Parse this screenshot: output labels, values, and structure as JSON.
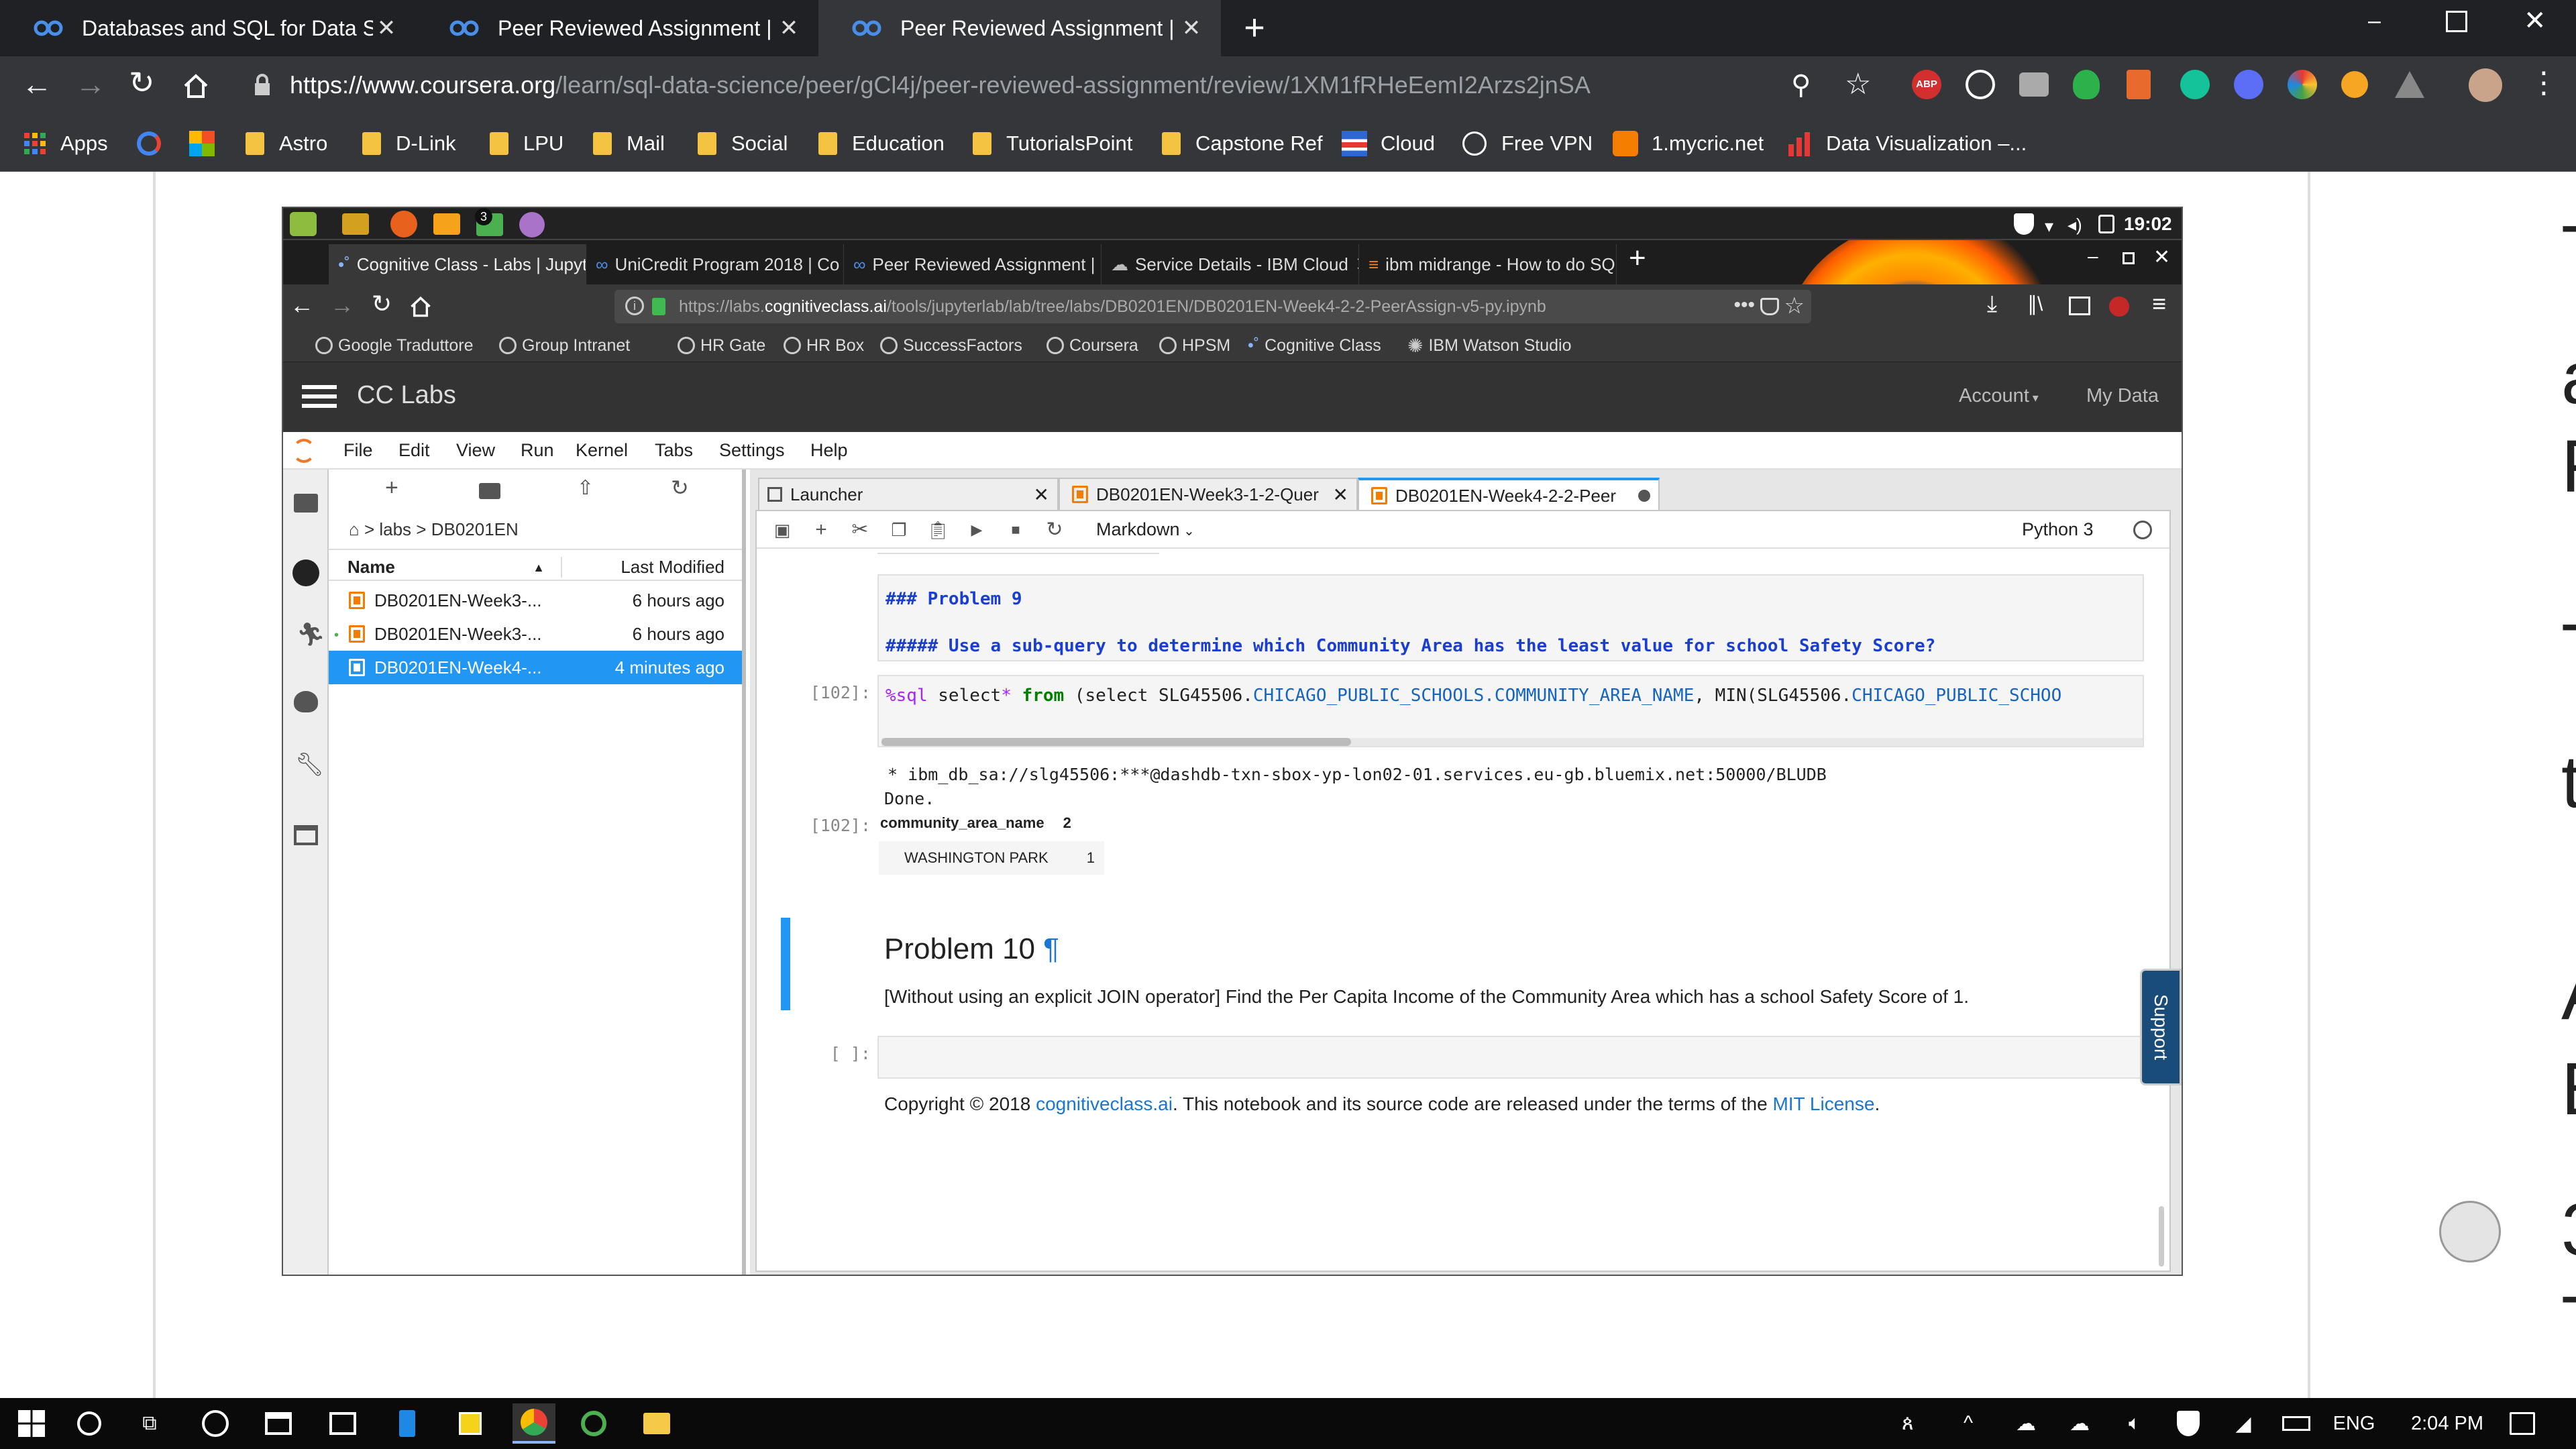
{
  "outer_browser": {
    "tabs": [
      {
        "title": "Databases and SQL for Data Scie"
      },
      {
        "title": "Peer Reviewed Assignment | Cou"
      },
      {
        "title": "Peer Reviewed Assignment | Cou"
      }
    ],
    "url_host": "https://www.coursera.org",
    "url_path": "/learn/sql-data-science/peer/gCl4j/peer-reviewed-assignment/review/1XM1fRHeEemI2Arzs2jnSA",
    "extension_abp": "ABP",
    "bookmarks": [
      "Apps",
      "Astro",
      "D-Link",
      "LPU",
      "Mail",
      "Social",
      "Education",
      "TutorialsPoint",
      "Capstone Ref",
      "Cloud",
      "Free VPN",
      "1.mycric.net",
      "Data Visualization –..."
    ],
    "right_page_chars": [
      "T",
      "a",
      "F",
      "T",
      "t",
      "A",
      "E",
      "3",
      "T"
    ]
  },
  "inner_desktop": {
    "clock": "19:02",
    "badge": "3"
  },
  "firefox": {
    "tabs": [
      {
        "title": "Cognitive Class - Labs | Jupyt"
      },
      {
        "title": "UniCredit Program 2018 | Co"
      },
      {
        "title": "Peer Reviewed Assignment |"
      },
      {
        "title": "Service Details - IBM Cloud"
      },
      {
        "title": "ibm midrange - How to do SQ"
      }
    ],
    "url_pre": "https://labs.",
    "url_host": "cognitiveclass.ai",
    "url_post": "/tools/jupyterlab/lab/tree/labs/DB0201EN/DB0201EN-Week4-2-2-PeerAssign-v5-py.ipynb",
    "bookmarks": [
      "Google Traduttore",
      "Group Intranet",
      "HR Gate",
      "HR Box",
      "SuccessFactors",
      "Coursera",
      "HPSM",
      "Cognitive Class",
      "IBM Watson Studio"
    ]
  },
  "cclabs": {
    "title": "CC Labs",
    "account": "Account",
    "mydata": "My Data"
  },
  "jupyter": {
    "menu": [
      "File",
      "Edit",
      "View",
      "Run",
      "Kernel",
      "Tabs",
      "Settings",
      "Help"
    ],
    "breadcrumb": "labs",
    "breadcrumb_folder": "DB0201EN",
    "file_headers": {
      "name": "Name",
      "modified": "Last Modified"
    },
    "files": [
      {
        "name": "DB0201EN-Week3-...",
        "modified": "6 hours ago"
      },
      {
        "name": "DB0201EN-Week3-...",
        "modified": "6 hours ago"
      },
      {
        "name": "DB0201EN-Week4-...",
        "modified": "4 minutes ago"
      }
    ],
    "tabs": [
      {
        "title": "Launcher"
      },
      {
        "title": "DB0201EN-Week3-1-2-Quer"
      },
      {
        "title": "DB0201EN-Week4-2-2-Peer"
      }
    ],
    "cell_type": "Markdown",
    "kernel": "Python 3",
    "support": "Support",
    "md_problem9_title": "### Problem 9",
    "md_problem9_body": "##### Use a sub-query to determine which Community Area has the least value for school Safety Score?",
    "code_prompt": "[102]:",
    "code_magic": "%sql",
    "code_kw1": "select",
    "code_op": "*",
    "code_kw2": "from",
    "code_p1": "(select SLG45506.",
    "code_c1": "CHICAGO_PUBLIC_SCHOOLS.COMMUNITY_AREA_NAME",
    "code_p2": ", MIN(SLG45506.",
    "code_c2": "CHICAGO_PUBLIC_SCHOO",
    "out_conn": " * ibm_db_sa://slg45506:***@dashdb-txn-sbox-yp-lon02-01.services.eu-gb.bluemix.net:50000/BLUDB",
    "out_done": "Done.",
    "out_prompt": "[102]:",
    "table_h1": "community_area_name",
    "table_h2": "2",
    "table_r1": "WASHINGTON PARK",
    "table_r2": "1",
    "problem10_title": "Problem 10",
    "pilcrow": "¶",
    "problem10_body": "[Without using an explicit JOIN operator] Find the Per Capita Income of the Community Area which has a school Safety Score of 1.",
    "empty_prompt": "[ ]:",
    "footer_pre": "Copyright © 2018",
    "footer_link1": "cognitiveclass.ai",
    "footer_mid": ". This notebook and its source code are released under the terms of the",
    "footer_link2": "MIT License",
    "footer_end": "."
  },
  "taskbar": {
    "lang": "ENG",
    "time": "2:04 PM"
  }
}
